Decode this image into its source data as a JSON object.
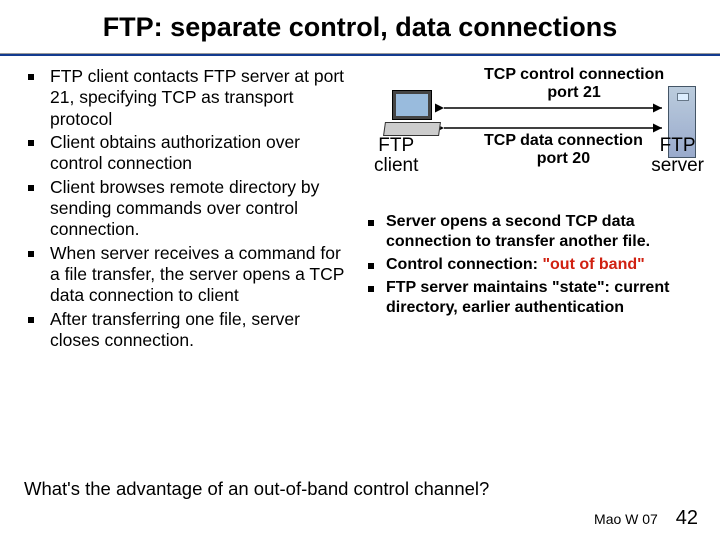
{
  "title": "FTP: separate control, data connections",
  "left_bullets": [
    "FTP client contacts FTP server at port 21, specifying TCP as transport protocol",
    "Client obtains authorization over control connection",
    "Client browses remote directory by sending commands over control connection.",
    "When server receives a command for a file transfer, the server opens a TCP data connection to client",
    "After transferring one file, server closes connection."
  ],
  "diagram": {
    "top_label_l1": "TCP control connection",
    "top_label_l2": "port 21",
    "mid_label_l1": "TCP data connection",
    "mid_label_l2": "port 20",
    "client_l1": "FTP",
    "client_l2": "client",
    "server_l1": "FTP",
    "server_l2": "server"
  },
  "right_bullets": [
    {
      "pre": "Server opens a second TCP data connection to transfer another file.",
      "hi": "",
      "post": ""
    },
    {
      "pre": "Control connection: ",
      "hi": "\"out of band\"",
      "post": ""
    },
    {
      "pre": "FTP server maintains \"state\": current directory, earlier authentication",
      "hi": "",
      "post": ""
    }
  ],
  "question": "What's the advantage of an out-of-band control channel?",
  "footer_left": "Mao W 07",
  "footer_page": "42"
}
